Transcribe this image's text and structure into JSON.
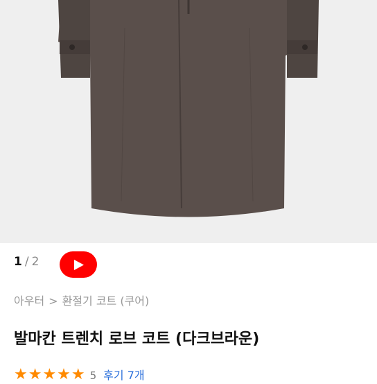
{
  "product_image": {
    "alt": "",
    "colors": {
      "coat": "#5a4f4b",
      "coat_dark": "#453c39",
      "background": "#efefef"
    }
  },
  "gallery": {
    "current": "1",
    "separator": "/",
    "total": "2"
  },
  "video_button": {
    "icon": "play-icon",
    "color": "#ff0000"
  },
  "breadcrumb": {
    "items": [
      "아우터",
      "환절기 코트 (쿠어)"
    ],
    "separator": ">"
  },
  "product": {
    "title": "발마칸 트렌치 로브 코트 (다크브라운)"
  },
  "rating": {
    "stars": "★★★★★",
    "score": "5",
    "reviews_label": "후기 7개",
    "star_color": "#ff8a00"
  }
}
